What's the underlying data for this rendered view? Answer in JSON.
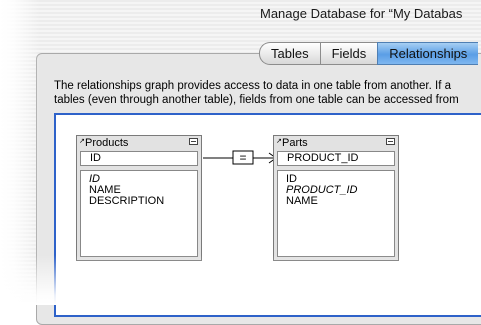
{
  "window": {
    "title": "Manage Database for “My Databas"
  },
  "tabs": [
    {
      "label": "Tables",
      "active": false
    },
    {
      "label": "Fields",
      "active": false
    },
    {
      "label": "Relationships",
      "active": true
    }
  ],
  "description": {
    "line1": "The relationships graph provides access to data in one table from another. If a",
    "line2": "tables (even through another table), fields from one table can be accessed from"
  },
  "graph": {
    "tables": [
      {
        "name": "Products",
        "key_field": "ID",
        "fields": [
          "ID",
          "NAME",
          "DESCRIPTION"
        ],
        "italic_fields": [
          "ID"
        ]
      },
      {
        "name": "Parts",
        "key_field": "PRODUCT_ID",
        "fields": [
          "ID",
          "PRODUCT_ID",
          "NAME"
        ],
        "italic_fields": [
          "PRODUCT_ID"
        ]
      }
    ],
    "relationship": {
      "operator": "="
    }
  },
  "colors": {
    "selection_border": "#2e62c9",
    "active_tab": "#5a9ee6"
  }
}
